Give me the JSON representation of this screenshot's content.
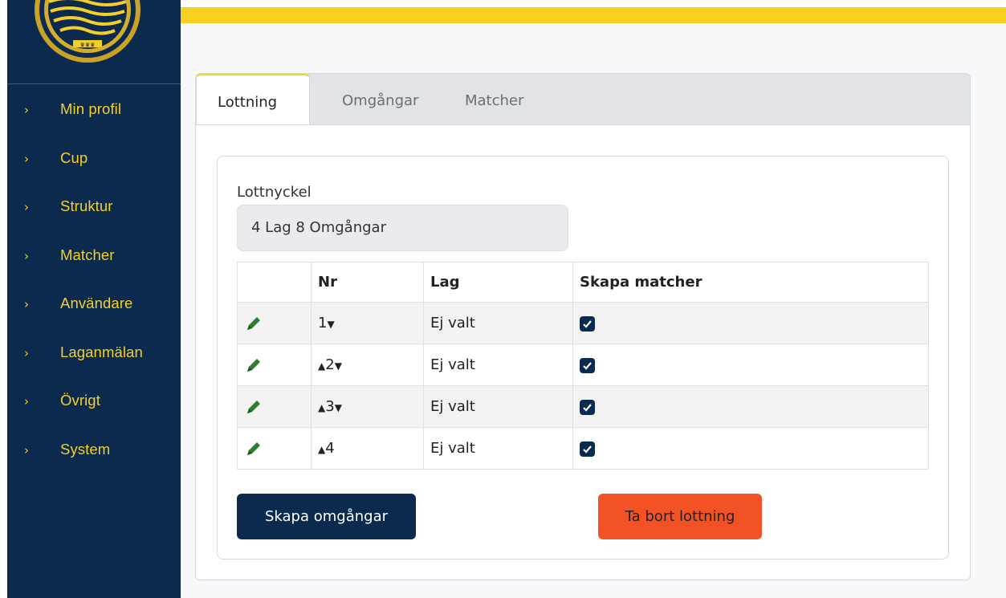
{
  "sidebar": {
    "items": [
      {
        "label": "Min profil"
      },
      {
        "label": "Cup"
      },
      {
        "label": "Struktur"
      },
      {
        "label": "Matcher"
      },
      {
        "label": "Användare"
      },
      {
        "label": "Laganmälan"
      },
      {
        "label": "Övrigt"
      },
      {
        "label": "System"
      }
    ],
    "chevron": "›"
  },
  "tabs": [
    {
      "label": "Lottning",
      "active": true
    },
    {
      "label": "Omgångar",
      "active": false
    },
    {
      "label": "Matcher",
      "active": false
    }
  ],
  "form": {
    "key_label": "Lottnyckel",
    "key_value": "4 Lag 8 Omgångar"
  },
  "table": {
    "headers": [
      "",
      "Nr",
      "Lag",
      "Skapa matcher"
    ],
    "rows": [
      {
        "nr": "1",
        "lag": "Ej valt",
        "skapa": true
      },
      {
        "nr": "2",
        "lag": "Ej valt",
        "skapa": true
      },
      {
        "nr": "3",
        "lag": "Ej valt",
        "skapa": true
      },
      {
        "nr": "4",
        "lag": "Ej valt",
        "skapa": true
      }
    ]
  },
  "buttons": {
    "create_rounds": "Skapa omgångar",
    "delete_draw": "Ta bort lottning"
  },
  "colors": {
    "sidebar_bg": "#0c2a4d",
    "accent_yellow": "#f7d021",
    "pencil_green": "#2e7d32",
    "danger": "#f25224"
  },
  "icons": {
    "edit": "pencil-icon",
    "sort_up": "caret-up-icon",
    "sort_down": "caret-down-icon",
    "checkbox": "checkbox-checked-icon",
    "logo": "emblem-logo"
  }
}
